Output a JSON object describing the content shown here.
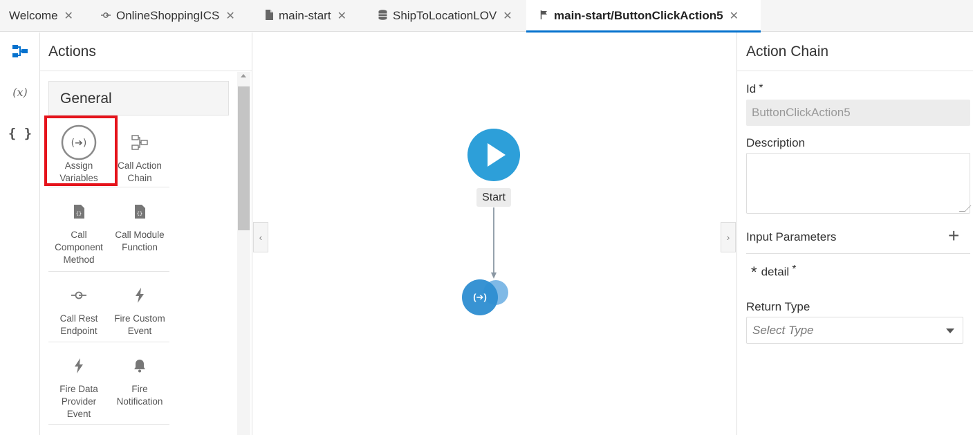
{
  "tabs": [
    {
      "label": "Welcome",
      "icon": ""
    },
    {
      "label": "OnlineShoppingICS",
      "icon": "service-connection-icon"
    },
    {
      "label": "main-start",
      "icon": "page-icon"
    },
    {
      "label": "ShipToLocationLOV",
      "icon": "database-icon"
    },
    {
      "label": "main-start/ButtonClickAction5",
      "icon": "flag-icon",
      "active": true
    }
  ],
  "palette": {
    "title": "Actions",
    "category": "General",
    "actions": [
      {
        "label_1": "Assign",
        "label_2": "Variables",
        "icon": "assign-variables-icon"
      },
      {
        "label_1": "Call Action",
        "label_2": "Chain",
        "icon": "call-action-chain-icon"
      },
      {
        "label_1": "Call",
        "label_2": "Component",
        "label_3": "Method",
        "icon": "file-code-icon"
      },
      {
        "label_1": "Call Module",
        "label_2": "Function",
        "icon": "file-code-icon"
      },
      {
        "label_1": "Call Rest",
        "label_2": "Endpoint",
        "icon": "rest-endpoint-icon"
      },
      {
        "label_1": "Fire Custom",
        "label_2": "Event",
        "icon": "lightning-icon"
      },
      {
        "label_1": "Fire Data",
        "label_2": "Provider",
        "label_3": "Event",
        "icon": "lightning-icon"
      },
      {
        "label_1": "Fire",
        "label_2": "Notification",
        "icon": "bell-icon"
      }
    ]
  },
  "canvas": {
    "start_label": "Start"
  },
  "properties": {
    "title": "Action Chain",
    "id_label": "Id",
    "required_mark": "*",
    "id_value": "ButtonClickAction5",
    "description_label": "Description",
    "input_params_label": "Input Parameters",
    "param_name": "detail",
    "param_prefix": "*",
    "return_type_label": "Return Type",
    "return_type_placeholder": "Select Type"
  },
  "colors": {
    "accent": "#0572ce",
    "start_node": "#2d9fd9",
    "highlight": "#e5131b"
  }
}
